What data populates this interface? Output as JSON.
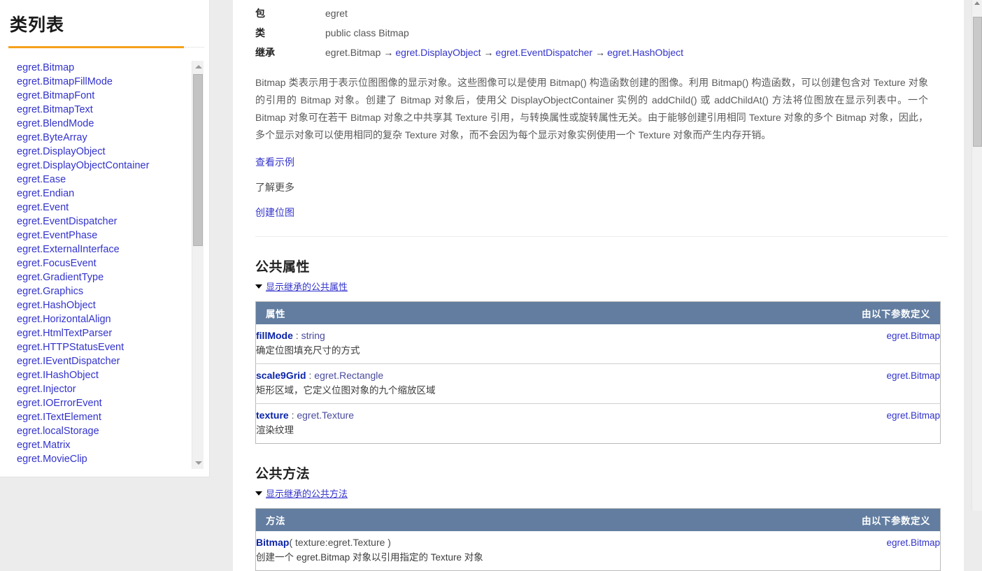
{
  "sidebar": {
    "title": "类列表",
    "classes": [
      "egret.Bitmap",
      "egret.BitmapFillMode",
      "egret.BitmapFont",
      "egret.BitmapText",
      "egret.BlendMode",
      "egret.ByteArray",
      "egret.DisplayObject",
      "egret.DisplayObjectContainer",
      "egret.Ease",
      "egret.Endian",
      "egret.Event",
      "egret.EventDispatcher",
      "egret.EventPhase",
      "egret.ExternalInterface",
      "egret.FocusEvent",
      "egret.GradientType",
      "egret.Graphics",
      "egret.HashObject",
      "egret.HorizontalAlign",
      "egret.HtmlTextParser",
      "egret.HTTPStatusEvent",
      "egret.IEventDispatcher",
      "egret.IHashObject",
      "egret.Injector",
      "egret.IOErrorEvent",
      "egret.ITextElement",
      "egret.localStorage",
      "egret.Matrix",
      "egret.MovieClip"
    ],
    "scroll_up_icon": "triangle-up-icon",
    "scroll_down_icon": "triangle-down-icon"
  },
  "meta": {
    "package_label": "包",
    "package_value": "egret",
    "class_label": "类",
    "class_value": "public class Bitmap",
    "inherit_label": "继承",
    "inherit_chain": [
      "egret.Bitmap",
      "egret.DisplayObject",
      "egret.EventDispatcher",
      "egret.HashObject"
    ],
    "arrow": "→"
  },
  "description": "Bitmap 类表示用于表示位图图像的显示对象。这些图像可以是使用 Bitmap() 构造函数创建的图像。利用 Bitmap() 构造函数，可以创建包含对 Texture 对象的引用的 Bitmap 对象。创建了 Bitmap 对象后，使用父 DisplayObjectContainer 实例的 addChild() 或 addChildAt() 方法将位图放在显示列表中。一个 Bitmap 对象可在若干 Bitmap 对象之中共享其 Texture 引用，与转换属性或旋转属性无关。由于能够创建引用相同 Texture 对象的多个 Bitmap 对象，因此，多个显示对象可以使用相同的复杂 Texture 对象，而不会因为每个显示对象实例使用一个 Texture 对象而产生内存开销。",
  "doc_links": [
    {
      "label": "查看示例",
      "muted": false
    },
    {
      "label": "了解更多",
      "muted": true
    },
    {
      "label": "创建位图",
      "muted": false
    }
  ],
  "properties_section": {
    "title": "公共属性",
    "toggle_label": "显示继承的公共属性",
    "col_name": "属性",
    "col_owner": "由以下参数定义",
    "rows": [
      {
        "name": "fillMode",
        "separator": " : ",
        "type": "string",
        "desc": "确定位图填充尺寸的方式",
        "owner": "egret.Bitmap"
      },
      {
        "name": "scale9Grid",
        "separator": " : ",
        "type": "egret.Rectangle",
        "desc": "矩形区域，它定义位图对象的九个缩放区域",
        "owner": "egret.Bitmap"
      },
      {
        "name": "texture",
        "separator": " : ",
        "type": "egret.Texture",
        "desc": "渲染纹理",
        "owner": "egret.Bitmap"
      }
    ]
  },
  "methods_section": {
    "title": "公共方法",
    "toggle_label": "显示继承的公共方法",
    "col_name": "方法",
    "col_owner": "由以下参数定义",
    "rows": [
      {
        "name": "Bitmap",
        "signature": "( texture:egret.Texture )",
        "desc": "创建一个 egret.Bitmap 对象以引用指定的 Texture 对象",
        "owner": "egret.Bitmap"
      }
    ]
  },
  "colors": {
    "accent_orange": "#f6a11b",
    "table_header": "#627da0",
    "link_blue": "#3333cc",
    "api_name_blue": "#0b24a8"
  }
}
